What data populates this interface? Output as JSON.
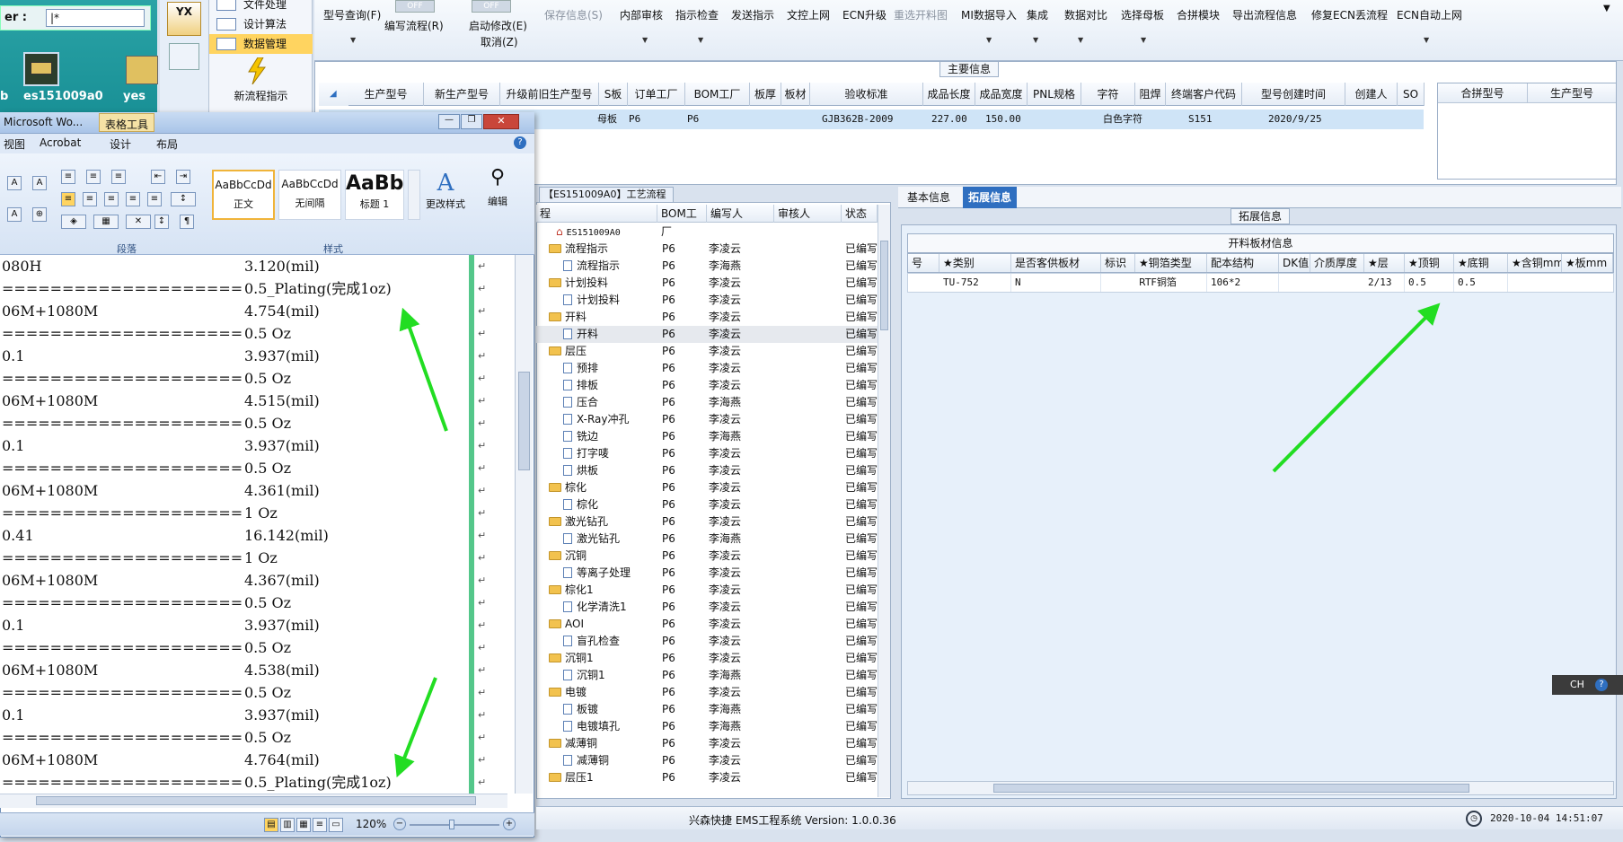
{
  "desktop": {
    "path_label": "er :",
    "path_value": "|*",
    "desktop_icons": [
      "b",
      "es151009a0",
      "yes"
    ]
  },
  "nav_menu": {
    "items": [
      "文件处理",
      "设计算法",
      "数据管理"
    ],
    "selected_index": 2,
    "new_process_label": "新流程指示",
    "yx_label": "YX"
  },
  "ribbon": {
    "toggle_label": "OFF",
    "buttons": [
      {
        "label": "型号查询(F)",
        "disabled": false
      },
      {
        "label": "编写流程(R)",
        "disabled": false
      },
      {
        "label": "启动修改(E)",
        "disabled": false
      },
      {
        "label": "取消(Z)",
        "disabled": false
      },
      {
        "label": "保存信息(S)",
        "disabled": true
      },
      {
        "label": "内部审核",
        "disabled": false
      },
      {
        "label": "指示检查",
        "disabled": false
      },
      {
        "label": "发送指示",
        "disabled": false
      },
      {
        "label": "文控上网",
        "disabled": false
      },
      {
        "label": "ECN升级",
        "disabled": false
      },
      {
        "label": "重选开料图",
        "disabled": true
      },
      {
        "label": "MI数据导入",
        "disabled": false
      },
      {
        "label": "集成",
        "disabled": false
      },
      {
        "label": "数据对比",
        "disabled": false
      },
      {
        "label": "选择母板",
        "disabled": false
      },
      {
        "label": "合拼模块",
        "disabled": false
      },
      {
        "label": "导出流程信息",
        "disabled": false
      },
      {
        "label": "修复ECN丢流程",
        "disabled": false
      },
      {
        "label": "ECN自动上网",
        "disabled": false
      }
    ]
  },
  "main_info": {
    "title": "主要信息",
    "columns": [
      "生产型号",
      "新生产型号",
      "升级前旧生产型号",
      "S板",
      "订单工厂",
      "BOM工厂",
      "板厚",
      "板材",
      "验收标准",
      "成品长度",
      "成品宽度",
      "PNL规格",
      "字符",
      "阻焊",
      "终端客户代码",
      "型号创建时间",
      "创建人",
      "SO"
    ],
    "row": [
      "母板",
      "P6",
      "P6",
      "GJB362B-2009",
      "227.00",
      "150.00",
      "白色字符",
      "S151",
      "2020/9/25"
    ],
    "side_columns": [
      "合拼型号",
      "生产型号"
    ]
  },
  "word": {
    "title": "Microsoft Wo...",
    "context_tab": "表格工具",
    "tabs": [
      "视图",
      "Acrobat",
      "设计",
      "布局"
    ],
    "styles": [
      {
        "sample": "AaBbCcDd",
        "name": "正文"
      },
      {
        "sample": "AaBbCcDd",
        "name": "无间隔"
      },
      {
        "sample": "AaBb",
        "name": "标题 1"
      }
    ],
    "change_style_label": "更改样式",
    "edit_label": "编辑",
    "group_paragraph": "段落",
    "group_style": "样式",
    "zoom": "120%",
    "lines": [
      {
        "left": "080H",
        "right": "3.120(mil)"
      },
      {
        "left": "====================",
        "right": "0.5_Plating(完成1oz)"
      },
      {
        "left": "06M+1080M",
        "right": "4.754(mil)"
      },
      {
        "left": "====================",
        "right": "0.5 Oz"
      },
      {
        "left": "0.1",
        "right": "3.937(mil)"
      },
      {
        "left": "====================",
        "right": "0.5 Oz"
      },
      {
        "left": "06M+1080M",
        "right": "4.515(mil)"
      },
      {
        "left": "====================",
        "right": "0.5 Oz"
      },
      {
        "left": "0.1",
        "right": "3.937(mil)"
      },
      {
        "left": "====================",
        "right": "0.5 Oz"
      },
      {
        "left": "06M+1080M",
        "right": "4.361(mil)"
      },
      {
        "left": "====================",
        "right": "1 Oz"
      },
      {
        "left": "0.41",
        "right": "16.142(mil)"
      },
      {
        "left": "====================",
        "right": "1 Oz"
      },
      {
        "left": "06M+1080M",
        "right": "4.367(mil)"
      },
      {
        "left": "====================",
        "right": "0.5 Oz"
      },
      {
        "left": "0.1",
        "right": "3.937(mil)"
      },
      {
        "left": "====================",
        "right": "0.5 Oz"
      },
      {
        "left": "06M+1080M",
        "right": "4.538(mil)"
      },
      {
        "left": "====================",
        "right": "0.5 Oz"
      },
      {
        "left": "0.1",
        "right": "3.937(mil)"
      },
      {
        "left": "====================",
        "right": "0.5 Oz"
      },
      {
        "left": "06M+1080M",
        "right": "4.764(mil)"
      },
      {
        "left": "====================",
        "right": "0.5_Plating(完成1oz)"
      }
    ]
  },
  "process": {
    "title": "【ES151009A0】工艺流程",
    "columns": [
      "程",
      "BOM工厂",
      "编写人",
      "审核人",
      "状态"
    ],
    "rows": [
      {
        "name": "ES151009A0",
        "level": 0,
        "type": "root",
        "factory": "",
        "writer": "",
        "status": ""
      },
      {
        "name": "流程指示",
        "level": 1,
        "type": "folder",
        "factory": "P6",
        "writer": "李凌云",
        "status": "已编写"
      },
      {
        "name": "流程指示",
        "level": 2,
        "type": "doc",
        "factory": "P6",
        "writer": "李海燕",
        "status": "已编写"
      },
      {
        "name": "计划投料",
        "level": 1,
        "type": "folder",
        "factory": "P6",
        "writer": "李凌云",
        "status": "已编写"
      },
      {
        "name": "计划投料",
        "level": 2,
        "type": "doc",
        "factory": "P6",
        "writer": "李凌云",
        "status": "已编写"
      },
      {
        "name": "开料",
        "level": 1,
        "type": "folder",
        "factory": "P6",
        "writer": "李凌云",
        "status": "已编写"
      },
      {
        "name": "开料",
        "level": 2,
        "type": "doc",
        "factory": "P6",
        "writer": "李凌云",
        "status": "已编写"
      },
      {
        "name": "层压",
        "level": 1,
        "type": "folder",
        "factory": "P6",
        "writer": "李凌云",
        "status": "已编写"
      },
      {
        "name": "预排",
        "level": 2,
        "type": "doc",
        "factory": "P6",
        "writer": "李凌云",
        "status": "已编写"
      },
      {
        "name": "排板",
        "level": 2,
        "type": "doc",
        "factory": "P6",
        "writer": "李凌云",
        "status": "已编写"
      },
      {
        "name": "压合",
        "level": 2,
        "type": "doc",
        "factory": "P6",
        "writer": "李海燕",
        "status": "已编写"
      },
      {
        "name": "X-Ray冲孔",
        "level": 2,
        "type": "doc",
        "factory": "P6",
        "writer": "李凌云",
        "status": "已编写"
      },
      {
        "name": "铣边",
        "level": 2,
        "type": "doc",
        "factory": "P6",
        "writer": "李海燕",
        "status": "已编写"
      },
      {
        "name": "打字唛",
        "level": 2,
        "type": "doc",
        "factory": "P6",
        "writer": "李凌云",
        "status": "已编写"
      },
      {
        "name": "烘板",
        "level": 2,
        "type": "doc",
        "factory": "P6",
        "writer": "李凌云",
        "status": "已编写"
      },
      {
        "name": "棕化",
        "level": 1,
        "type": "folder",
        "factory": "P6",
        "writer": "李凌云",
        "status": "已编写"
      },
      {
        "name": "棕化",
        "level": 2,
        "type": "doc",
        "factory": "P6",
        "writer": "李凌云",
        "status": "已编写"
      },
      {
        "name": "激光钻孔",
        "level": 1,
        "type": "folder",
        "factory": "P6",
        "writer": "李凌云",
        "status": "已编写"
      },
      {
        "name": "激光钻孔",
        "level": 2,
        "type": "doc",
        "factory": "P6",
        "writer": "李海燕",
        "status": "已编写"
      },
      {
        "name": "沉铜",
        "level": 1,
        "type": "folder",
        "factory": "P6",
        "writer": "李凌云",
        "status": "已编写"
      },
      {
        "name": "等离子处理",
        "level": 2,
        "type": "doc",
        "factory": "P6",
        "writer": "李凌云",
        "status": "已编写"
      },
      {
        "name": "棕化1",
        "level": 1,
        "type": "folder",
        "factory": "P6",
        "writer": "李凌云",
        "status": "已编写"
      },
      {
        "name": "化学清洗1",
        "level": 2,
        "type": "doc",
        "factory": "P6",
        "writer": "李凌云",
        "status": "已编写"
      },
      {
        "name": "AOI",
        "level": 1,
        "type": "folder",
        "factory": "P6",
        "writer": "李凌云",
        "status": "已编写"
      },
      {
        "name": "盲孔检查",
        "level": 2,
        "type": "doc",
        "factory": "P6",
        "writer": "李凌云",
        "status": "已编写"
      },
      {
        "name": "沉铜1",
        "level": 1,
        "type": "folder",
        "factory": "P6",
        "writer": "李凌云",
        "status": "已编写"
      },
      {
        "name": "沉铜1",
        "level": 2,
        "type": "doc",
        "factory": "P6",
        "writer": "李海燕",
        "status": "已编写"
      },
      {
        "name": "电镀",
        "level": 1,
        "type": "folder",
        "factory": "P6",
        "writer": "李凌云",
        "status": "已编写"
      },
      {
        "name": "板镀",
        "level": 2,
        "type": "doc",
        "factory": "P6",
        "writer": "李海燕",
        "status": "已编写"
      },
      {
        "name": "电镀填孔",
        "level": 2,
        "type": "doc",
        "factory": "P6",
        "writer": "李海燕",
        "status": "已编写"
      },
      {
        "name": "减薄铜",
        "level": 1,
        "type": "folder",
        "factory": "P6",
        "writer": "李凌云",
        "status": "已编写"
      },
      {
        "name": "减薄铜",
        "level": 2,
        "type": "doc",
        "factory": "P6",
        "writer": "李凌云",
        "status": "已编写"
      },
      {
        "name": "层压1",
        "level": 1,
        "type": "folder",
        "factory": "P6",
        "writer": "李凌云",
        "status": "已编写"
      }
    ]
  },
  "right": {
    "tabs": [
      "基本信息",
      "拓展信息"
    ],
    "active_tab": 1,
    "section_title": "拓展信息",
    "table_title": "开料板材信息",
    "columns": [
      "号",
      "★类别",
      "是否客供板材",
      "标识",
      "★铜箔类型",
      "配本结构",
      "DK值",
      "介质厚度",
      "★层",
      "★顶铜",
      "★底铜",
      "★含铜mm",
      "★板mm"
    ],
    "row": [
      "",
      "TU-752",
      "N",
      "",
      "RTF铜箔",
      "106*2",
      "",
      "",
      "2/13",
      "0.5",
      "0.5",
      "",
      ""
    ]
  },
  "status": {
    "company": "兴森快捷 EMS工程系统 Version: 1.0.0.36",
    "datetime": "2020-10-04 14:51:07"
  },
  "ime": {
    "label": "CH"
  },
  "colors": {
    "arrow": "#22dd22",
    "selection": "#ffd460",
    "accent": "#2f6fc0"
  }
}
